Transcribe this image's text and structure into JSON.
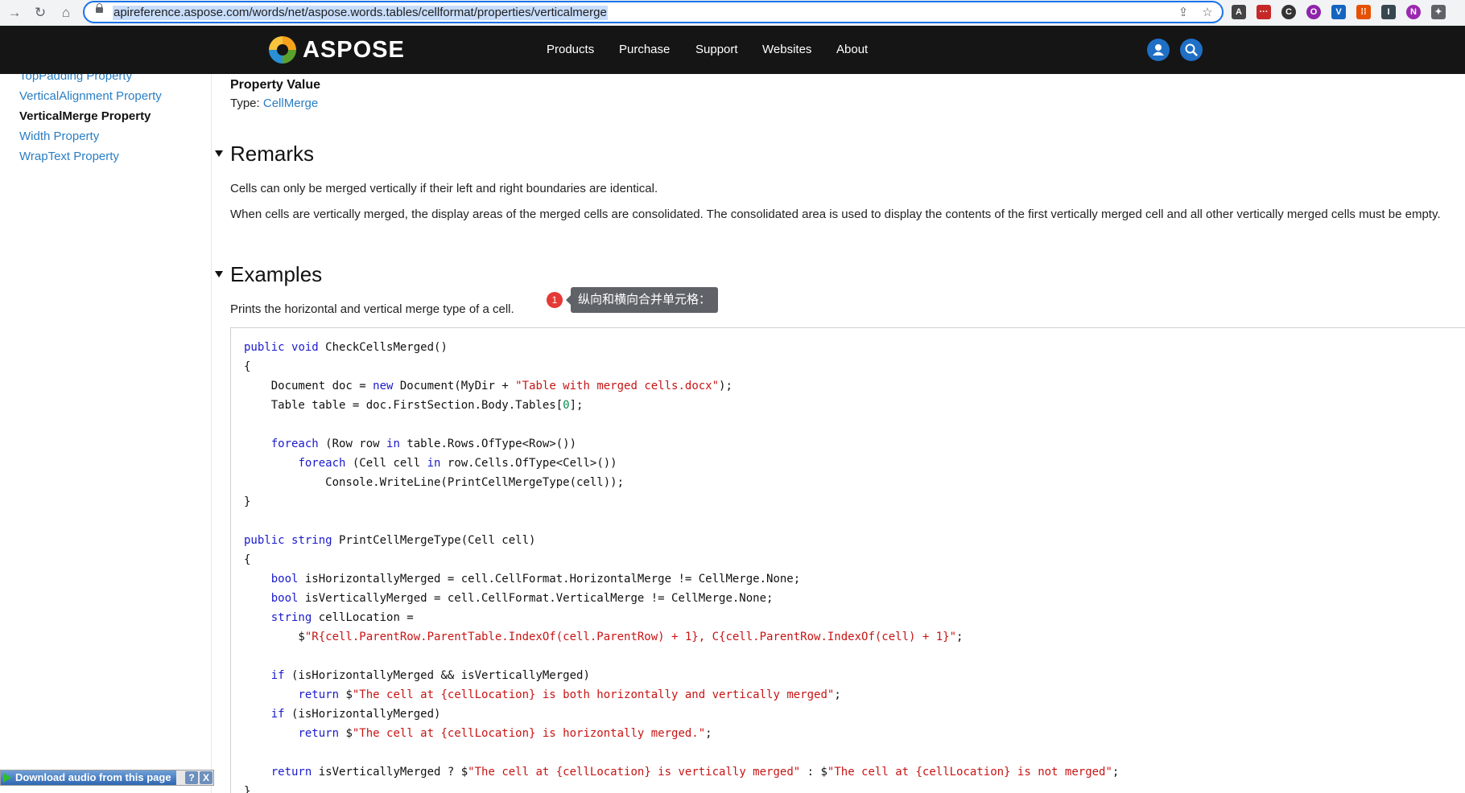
{
  "browser": {
    "url": "apireference.aspose.com/words/net/aspose.words.tables/cellformat/properties/verticalmerge",
    "back_icon": "arrow-right-icon",
    "reload_icon": "reload-icon",
    "home_icon": "home-icon",
    "share_icon": "share-icon",
    "star_icon": "star-icon",
    "extensions": [
      "A",
      "···",
      "C",
      "O",
      "V",
      "⁞⁞",
      "I",
      "N",
      "✦"
    ]
  },
  "header": {
    "logo": "ASPOSE",
    "nav": [
      "Products",
      "Purchase",
      "Support",
      "Websites",
      "About"
    ]
  },
  "sidebar": {
    "items": [
      {
        "label": "TopPadding Property",
        "active": false
      },
      {
        "label": "VerticalAlignment Property",
        "active": false
      },
      {
        "label": "VerticalMerge Property",
        "active": true
      },
      {
        "label": "Width Property",
        "active": false
      },
      {
        "label": "WrapText Property",
        "active": false
      }
    ]
  },
  "content": {
    "property_value_title": "Property Value",
    "type_prefix": "Type: ",
    "type_link": "CellMerge",
    "remarks_heading": "Remarks",
    "remarks": [
      "Cells can only be merged vertically if their left and right boundaries are identical.",
      "When cells are vertically merged, the display areas of the merged cells are consolidated. The consolidated area is used to display the contents of the first vertically merged cell and all other vertically merged cells must be empty."
    ],
    "examples_heading": "Examples",
    "example_desc": "Prints the horizontal and vertical merge type of a cell.",
    "annotation_number": "1",
    "annotation_text": "纵向和横向合并单元格："
  },
  "code_lines": [
    [
      [
        "kw",
        "public"
      ],
      [
        "t",
        " "
      ],
      [
        "kw",
        "void"
      ],
      [
        "t",
        " CheckCellsMerged()"
      ]
    ],
    [
      [
        "t",
        "{"
      ]
    ],
    [
      [
        "t",
        "    Document doc = "
      ],
      [
        "kw",
        "new"
      ],
      [
        "t",
        " Document(MyDir + "
      ],
      [
        "str",
        "\"Table with merged cells.docx\""
      ],
      [
        "t",
        ");"
      ]
    ],
    [
      [
        "t",
        "    Table table = doc.FirstSection.Body.Tables["
      ],
      [
        "num",
        "0"
      ],
      [
        "t",
        "];"
      ]
    ],
    [
      [
        "t",
        ""
      ]
    ],
    [
      [
        "t",
        "    "
      ],
      [
        "kw",
        "foreach"
      ],
      [
        "t",
        " (Row row "
      ],
      [
        "kw",
        "in"
      ],
      [
        "t",
        " table.Rows.OfType<Row>())"
      ]
    ],
    [
      [
        "t",
        "        "
      ],
      [
        "kw",
        "foreach"
      ],
      [
        "t",
        " (Cell cell "
      ],
      [
        "kw",
        "in"
      ],
      [
        "t",
        " row.Cells.OfType<Cell>())"
      ]
    ],
    [
      [
        "t",
        "            Console.WriteLine(PrintCellMergeType(cell));"
      ]
    ],
    [
      [
        "t",
        "}"
      ]
    ],
    [
      [
        "t",
        ""
      ]
    ],
    [
      [
        "kw",
        "public"
      ],
      [
        "t",
        " "
      ],
      [
        "kw",
        "string"
      ],
      [
        "t",
        " PrintCellMergeType(Cell cell)"
      ]
    ],
    [
      [
        "t",
        "{"
      ]
    ],
    [
      [
        "t",
        "    "
      ],
      [
        "kw",
        "bool"
      ],
      [
        "t",
        " isHorizontallyMerged = cell.CellFormat.HorizontalMerge != CellMerge.None;"
      ]
    ],
    [
      [
        "t",
        "    "
      ],
      [
        "kw",
        "bool"
      ],
      [
        "t",
        " isVerticallyMerged = cell.CellFormat.VerticalMerge != CellMerge.None;"
      ]
    ],
    [
      [
        "t",
        "    "
      ],
      [
        "kw",
        "string"
      ],
      [
        "t",
        " cellLocation ="
      ]
    ],
    [
      [
        "t",
        "        $"
      ],
      [
        "str",
        "\"R{cell.ParentRow.ParentTable.IndexOf(cell.ParentRow) + 1}, C{cell.ParentRow.IndexOf(cell) + 1}\""
      ],
      [
        "t",
        ";"
      ]
    ],
    [
      [
        "t",
        ""
      ]
    ],
    [
      [
        "t",
        "    "
      ],
      [
        "kw",
        "if"
      ],
      [
        "t",
        " (isHorizontallyMerged && isVerticallyMerged)"
      ]
    ],
    [
      [
        "t",
        "        "
      ],
      [
        "kw",
        "return"
      ],
      [
        "t",
        " $"
      ],
      [
        "str",
        "\"The cell at {cellLocation} is both horizontally and vertically merged\""
      ],
      [
        "t",
        ";"
      ]
    ],
    [
      [
        "t",
        "    "
      ],
      [
        "kw",
        "if"
      ],
      [
        "t",
        " (isHorizontallyMerged)"
      ]
    ],
    [
      [
        "t",
        "        "
      ],
      [
        "kw",
        "return"
      ],
      [
        "t",
        " $"
      ],
      [
        "str",
        "\"The cell at {cellLocation} is horizontally merged.\""
      ],
      [
        "t",
        ";"
      ]
    ],
    [
      [
        "t",
        ""
      ]
    ],
    [
      [
        "t",
        "    "
      ],
      [
        "kw",
        "return"
      ],
      [
        "t",
        " isVerticallyMerged ? $"
      ],
      [
        "str",
        "\"The cell at {cellLocation} is vertically merged\""
      ],
      [
        "t",
        " : $"
      ],
      [
        "str",
        "\"The cell at {cellLocation} is not merged\""
      ],
      [
        "t",
        ";"
      ]
    ],
    [
      [
        "t",
        "}"
      ]
    ]
  ],
  "audio_bar": {
    "label": "Download audio from this page",
    "help": "?",
    "close": "X"
  }
}
